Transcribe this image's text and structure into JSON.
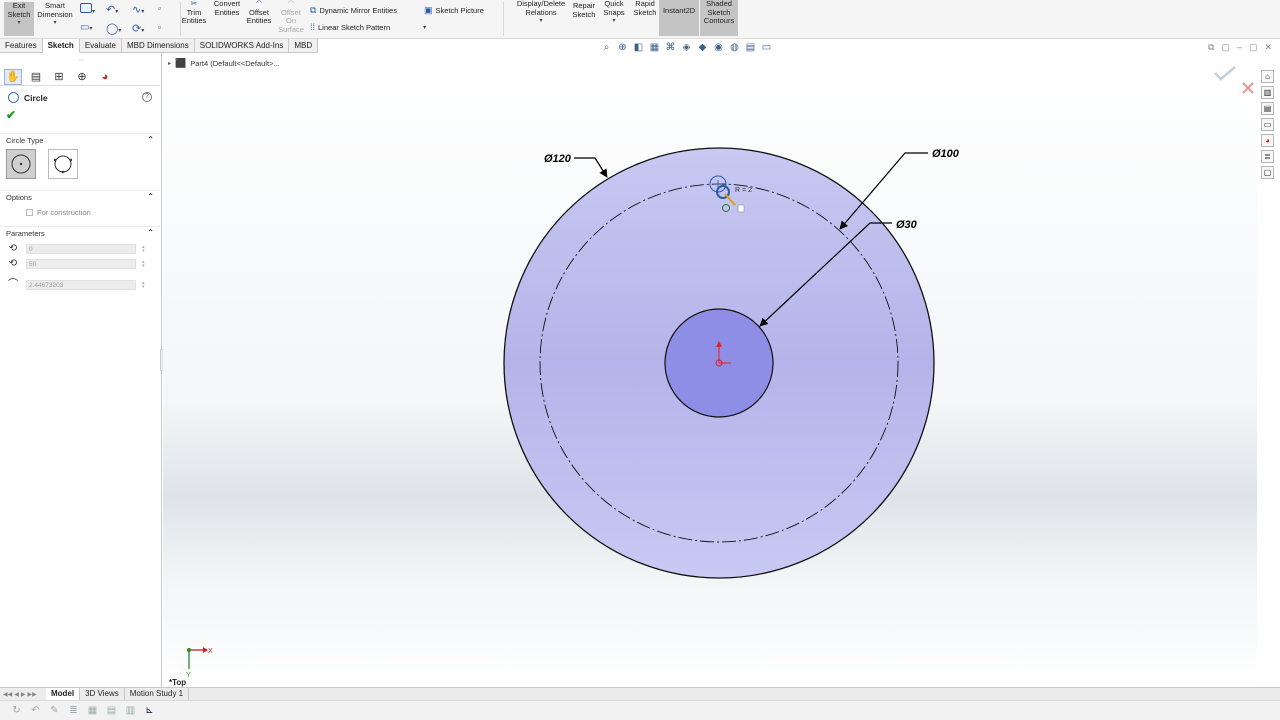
{
  "ribbon": {
    "exit_sketch": "Exit\nSketch",
    "smart_dimension": "Smart\nDimension",
    "trim_entities": "Trim\nEntities",
    "convert_entities": "Convert\nEntities",
    "offset_entities": "Offset\nEntities",
    "offset_on_surface": "Offset\nOn\nSurface",
    "dynamic_mirror": "Dynamic Mirror Entities",
    "linear_sketch_pattern": "Linear Sketch Pattern",
    "sketch_picture": "Sketch Picture",
    "display_delete_relations": "Display/Delete\nRelations",
    "repair_sketch": "Repair\nSketch",
    "quick_snaps": "Quick\nSnaps",
    "rapid_sketch": "Rapid\nSketch",
    "instant2d": "Instant2D",
    "shaded_sketch_contours": "Shaded\nSketch\nContours"
  },
  "cm_tabs": [
    "Features",
    "Sketch",
    "Evaluate",
    "MBD Dimensions",
    "SOLIDWORKS Add-Ins",
    "MBD"
  ],
  "cm_active": "Sketch",
  "property_manager": {
    "title": "Circle",
    "help": "?",
    "circle_type_label": "Circle Type",
    "options_label": "Options",
    "for_construction": "For construction",
    "parameters_label": "Parameters",
    "param_x": "0",
    "param_y": "50",
    "param_r": "2.44673203"
  },
  "feature_tree": {
    "part_label": "Part4  (Default<<Default>..."
  },
  "drawing": {
    "outer_dim": "Ø120",
    "construction_dim": "Ø100",
    "inner_dim": "Ø30",
    "cursor_readout": "R = 2",
    "view_label": "*Top",
    "axis_x": "X",
    "axis_y": "Y"
  },
  "bottom_tabs": [
    "Model",
    "3D Views",
    "Motion Study 1"
  ],
  "bottom_active": "Model",
  "colors": {
    "fill_outer": "#c6c6f0",
    "fill_inner": "#8f8fe6",
    "accent_blue": "#2a5ba8",
    "origin_red": "#e02020"
  }
}
